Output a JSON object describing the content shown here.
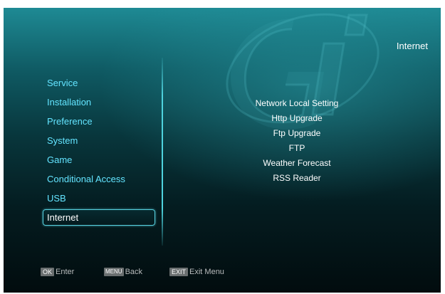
{
  "header": {
    "title": "Internet"
  },
  "main_menu": {
    "items": [
      {
        "label": "Service"
      },
      {
        "label": "Installation"
      },
      {
        "label": "Preference"
      },
      {
        "label": "System"
      },
      {
        "label": "Game"
      },
      {
        "label": "Conditional Access"
      },
      {
        "label": "USB"
      },
      {
        "label": "Internet"
      }
    ],
    "selected": "Internet"
  },
  "submenu": {
    "items": [
      {
        "label": "Network Local Setting"
      },
      {
        "label": "Http Upgrade"
      },
      {
        "label": "Ftp Upgrade"
      },
      {
        "label": "FTP"
      },
      {
        "label": "Weather Forecast"
      },
      {
        "label": "RSS Reader"
      }
    ]
  },
  "footer": {
    "hints": [
      {
        "key": "OK",
        "label": "Enter"
      },
      {
        "key": "MENU",
        "label": "Back"
      },
      {
        "key": "EXIT",
        "label": "Exit Menu"
      }
    ]
  },
  "colors": {
    "menu_text": "#63e4ff",
    "selected_border": "#57d2e0",
    "background_top": "#1e8a94",
    "background_bottom": "#020c0e"
  },
  "icons": {
    "logo": "gi-logo-icon"
  }
}
